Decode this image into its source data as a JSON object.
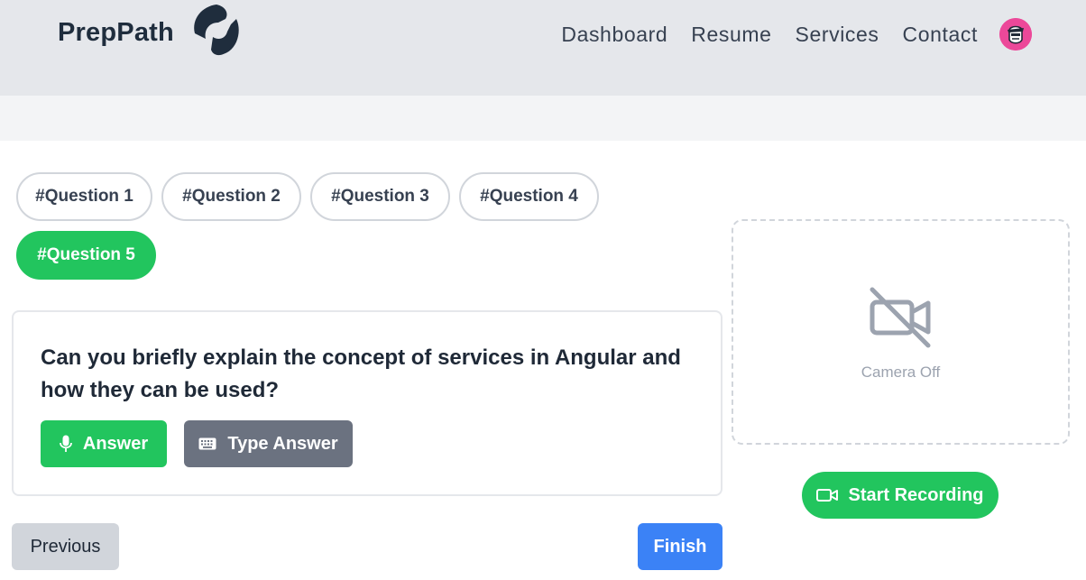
{
  "header": {
    "brand": "PrepPath",
    "nav": [
      "Dashboard",
      "Resume",
      "Services",
      "Contact"
    ]
  },
  "tabs": [
    {
      "label": "#Question 1",
      "active": false
    },
    {
      "label": "#Question 2",
      "active": false
    },
    {
      "label": "#Question 3",
      "active": false
    },
    {
      "label": "#Question 4",
      "active": false
    },
    {
      "label": "#Question 5",
      "active": true
    }
  ],
  "question": {
    "text": "Can you briefly explain the concept of services in Angular and how they can be used?",
    "answer_label": "Answer",
    "type_answer_label": "Type Answer"
  },
  "footer": {
    "previous_label": "Previous",
    "finish_label": "Finish"
  },
  "camera": {
    "status": "Camera Off",
    "record_label": "Start Recording"
  },
  "colors": {
    "accent_green": "#22c55e",
    "accent_blue": "#3b82f6",
    "neutral_gray": "#6b7280"
  }
}
